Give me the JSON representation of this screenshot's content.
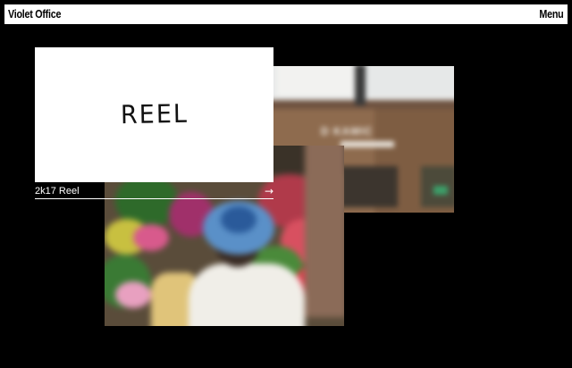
{
  "header": {
    "brand": "Violet Office",
    "menu_label": "Menu"
  },
  "featured": {
    "card_text": "REEL",
    "caption": "2k17 Reel",
    "arrow_icon": "arrow-right-icon",
    "arrow_glyph": "→"
  },
  "backgrounds": {
    "photo_building_sign": "D KAMIC",
    "page_color": "#000000",
    "header_color": "#ffffff"
  }
}
